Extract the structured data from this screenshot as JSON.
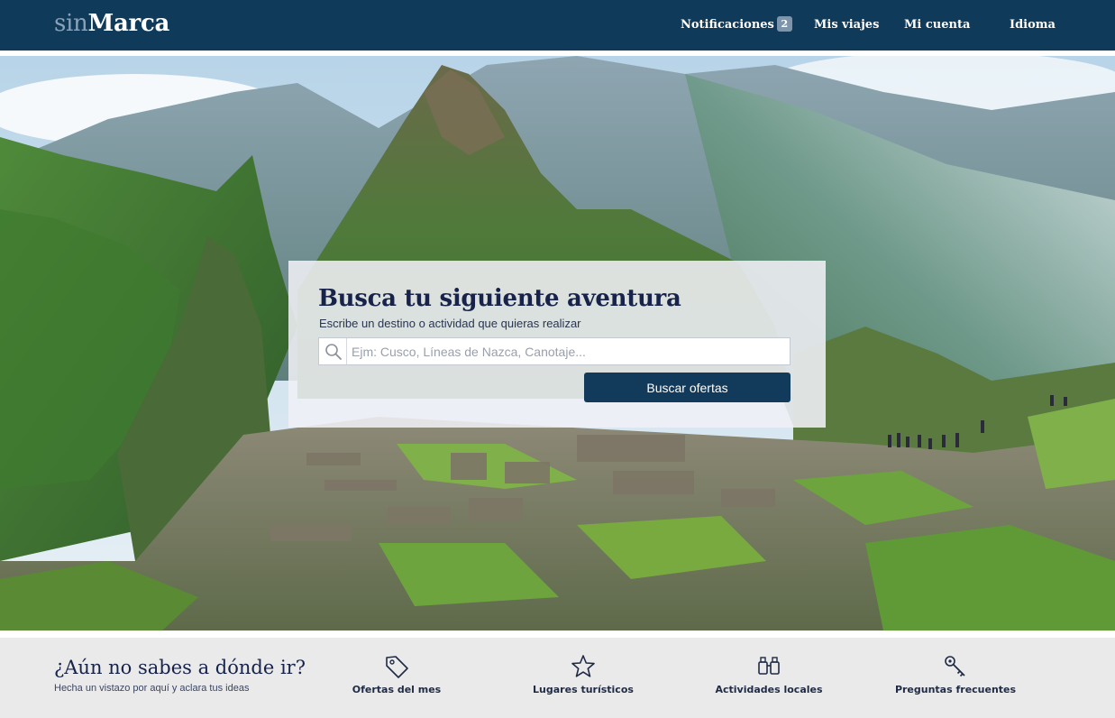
{
  "header": {
    "logo_light": "sin",
    "logo_bold": "Marca",
    "nav": {
      "notifications": "Notificaciones",
      "notifications_count": "2",
      "trips": "Mis viajes",
      "account": "Mi cuenta",
      "language": "Idioma"
    },
    "bg_color": "#0f3a5a"
  },
  "hero": {
    "image": "mountain-ruins-landscape",
    "search": {
      "title": "Busca tu siguiente aventura",
      "subtitle": "Escribe un destino o actividad que quieras realizar",
      "placeholder": "Ejm: Cusco, Líneas de Nazca, Canotaje...",
      "value": "",
      "button": "Buscar ofertas",
      "icon": "search-icon"
    }
  },
  "discover": {
    "title": "¿Aún no sabes a dónde ir?",
    "subtitle": "Hecha un vistazo por aquí y aclara tus ideas",
    "links": [
      {
        "label": "Ofertas del mes",
        "icon": "tag-icon"
      },
      {
        "label": "Lugares turísticos",
        "icon": "star-icon"
      },
      {
        "label": "Actividades locales",
        "icon": "binoculars-icon"
      },
      {
        "label": "Preguntas frecuentes",
        "icon": "key-icon"
      }
    ]
  },
  "colors": {
    "brand": "#0f3a5a",
    "button": "#123a5a",
    "heading": "#17234a"
  }
}
